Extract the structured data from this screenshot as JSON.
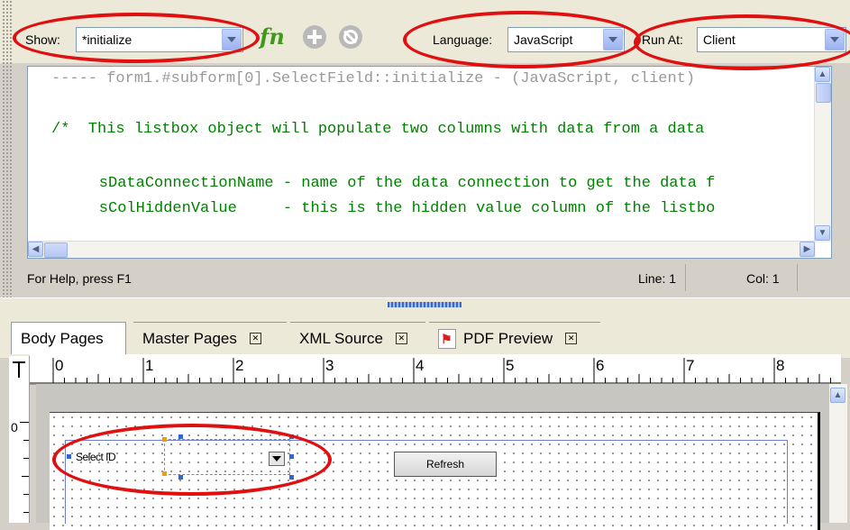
{
  "toolbar": {
    "show_label": "Show:",
    "show_value": "*initialize",
    "fn_label": "fn",
    "language_label": "Language:",
    "language_value": "JavaScript",
    "run_at_label": "Run At:",
    "run_at_value": "Client"
  },
  "editor": {
    "lines": [
      "----- form1.#subform[0].SelectField::initialize - (JavaScript, client)",
      "",
      "/*  This listbox object will populate two columns with data from a data",
      "",
      "    sDataConnectionName - name of the data connection to get the data f",
      "    sColHiddenValue     - this is the hidden value column of the listbo"
    ]
  },
  "status": {
    "help": "For Help, press F1",
    "line": "Line: 1",
    "col": "Col: 1"
  },
  "tabs": [
    {
      "label": "Body Pages"
    },
    {
      "label": "Master Pages"
    },
    {
      "label": "XML Source"
    },
    {
      "label": "PDF Preview"
    }
  ],
  "ruler": {
    "numbers": [
      "0",
      "1",
      "2",
      "3",
      "4",
      "5",
      "6",
      "7",
      "8"
    ],
    "vertical_zero": "0"
  },
  "form": {
    "select_label": "Select ID",
    "refresh_label": "Refresh"
  },
  "colors": {
    "annotation_red": "#e01010",
    "code_comment_green": "#008000",
    "code_header_gray": "#999999"
  }
}
